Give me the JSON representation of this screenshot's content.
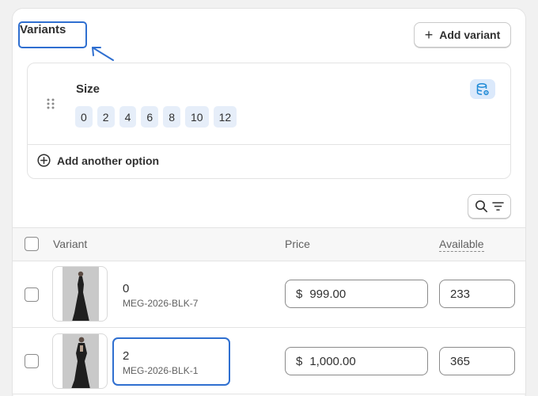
{
  "section": {
    "title": "Variants",
    "add_variant_label": "Add variant"
  },
  "option": {
    "name": "Size",
    "values": [
      "0",
      "2",
      "4",
      "6",
      "8",
      "10",
      "12"
    ],
    "add_another_label": "Add another option"
  },
  "table": {
    "headers": {
      "variant": "Variant",
      "price": "Price",
      "available": "Available"
    },
    "currency_symbol": "$",
    "rows": [
      {
        "name": "0",
        "sku": "MEG-2026-BLK-7",
        "price": "999.00",
        "available": "233"
      },
      {
        "name": "2",
        "sku": "MEG-2026-BLK-1",
        "price": "1,000.00",
        "available": "365"
      }
    ]
  },
  "colors": {
    "accent": "#2f6fd0",
    "chip_bg": "#e6eef9",
    "icon_blue": "#1f8ad6"
  }
}
